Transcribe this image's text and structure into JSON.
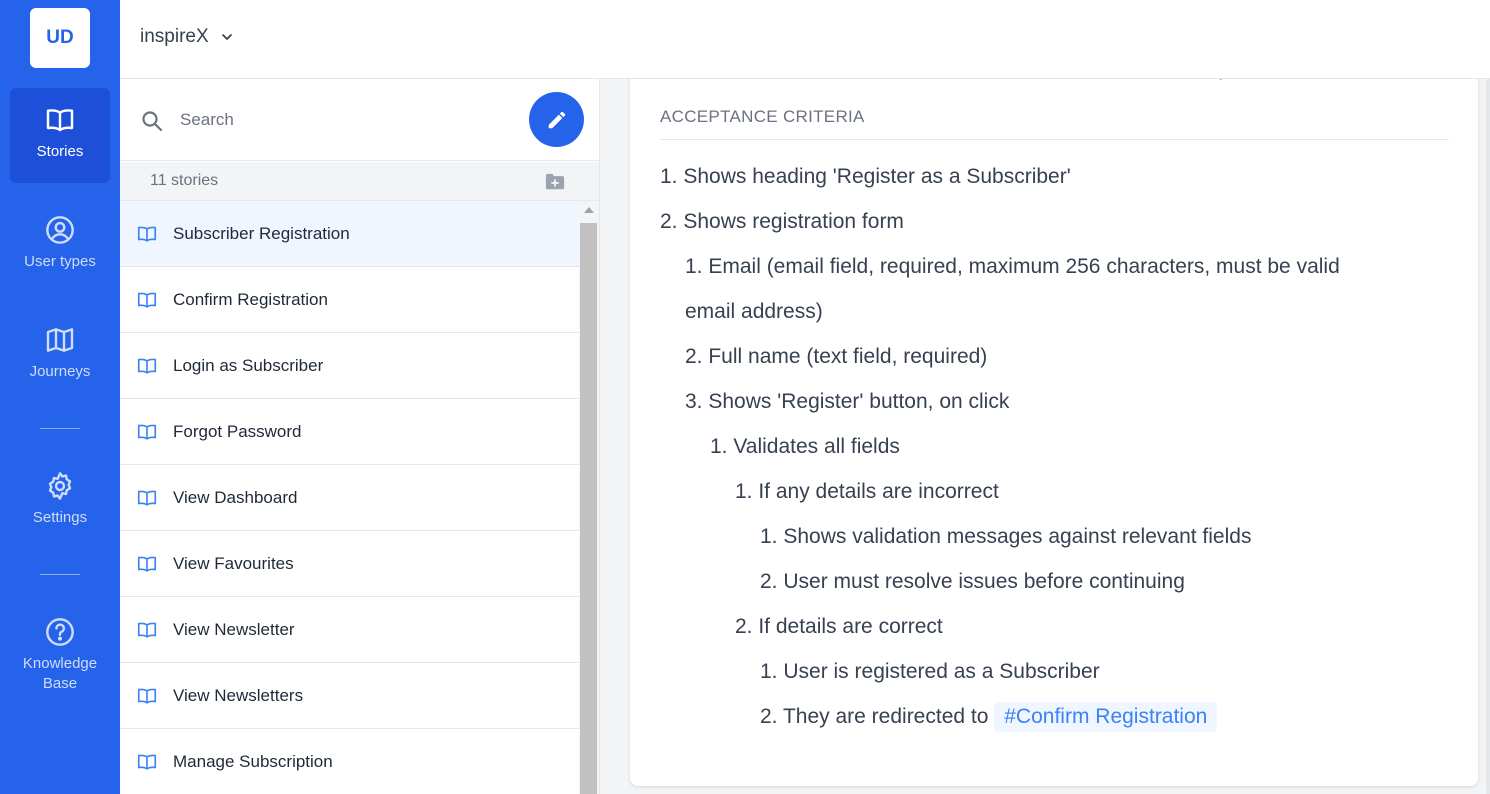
{
  "rail": {
    "logo": "UD",
    "items": [
      {
        "label": "Stories",
        "icon": "book-open-icon",
        "active": true
      },
      {
        "label": "User types",
        "icon": "user-circle-icon",
        "active": false
      },
      {
        "label": "Journeys",
        "icon": "map-icon",
        "active": false
      },
      {
        "label": "Settings",
        "icon": "gear-icon",
        "active": false
      },
      {
        "label": "Knowledge Base",
        "icon": "question-circle-icon",
        "active": false
      }
    ]
  },
  "topbar": {
    "project": "inspireX",
    "project_icon": "chevron-down-icon"
  },
  "stories_panel": {
    "search_placeholder": "Search",
    "count": "11 stories",
    "items": [
      {
        "label": "Subscriber Registration",
        "selected": true
      },
      {
        "label": "Confirm Registration",
        "selected": false
      },
      {
        "label": "Login as Subscriber",
        "selected": false
      },
      {
        "label": "Forgot Password",
        "selected": false
      },
      {
        "label": "View Dashboard",
        "selected": false
      },
      {
        "label": "View Favourites",
        "selected": false
      },
      {
        "label": "View Newsletter",
        "selected": false
      },
      {
        "label": "View Newsletters",
        "selected": false
      },
      {
        "label": "Manage Subscription",
        "selected": false
      }
    ]
  },
  "detail": {
    "section_title": "ACCEPTANCE CRITERIA",
    "criteria": [
      {
        "level": 0,
        "text": "1. Shows heading 'Register as a Subscriber'"
      },
      {
        "level": 0,
        "text": "2. Shows registration form"
      },
      {
        "level": 1,
        "text": "1. Email (email field, required, maximum 256 characters, must be valid"
      },
      {
        "level": 1,
        "text": "email address)",
        "continuation": true
      },
      {
        "level": 1,
        "text": "2. Full name (text field, required)"
      },
      {
        "level": 1,
        "text": "3. Shows 'Register' button, on click"
      },
      {
        "level": 2,
        "text": "1. Validates all fields"
      },
      {
        "level": 3,
        "text": "1. If any details are incorrect"
      },
      {
        "level": 4,
        "text": "1. Shows validation messages against relevant fields"
      },
      {
        "level": 4,
        "text": "2. User must resolve issues before continuing"
      },
      {
        "level": 3,
        "text": "2. If details are correct"
      },
      {
        "level": 4,
        "text": "1. User is registered as a Subscriber"
      },
      {
        "level": 4,
        "text": "2. They are redirected to ",
        "mention": "#Confirm Registration"
      }
    ]
  },
  "colors": {
    "accent": "#2563eb",
    "rail_active": "#1d4fd8",
    "selected_row": "#eff6ff",
    "mention_text": "#3b82f6"
  }
}
